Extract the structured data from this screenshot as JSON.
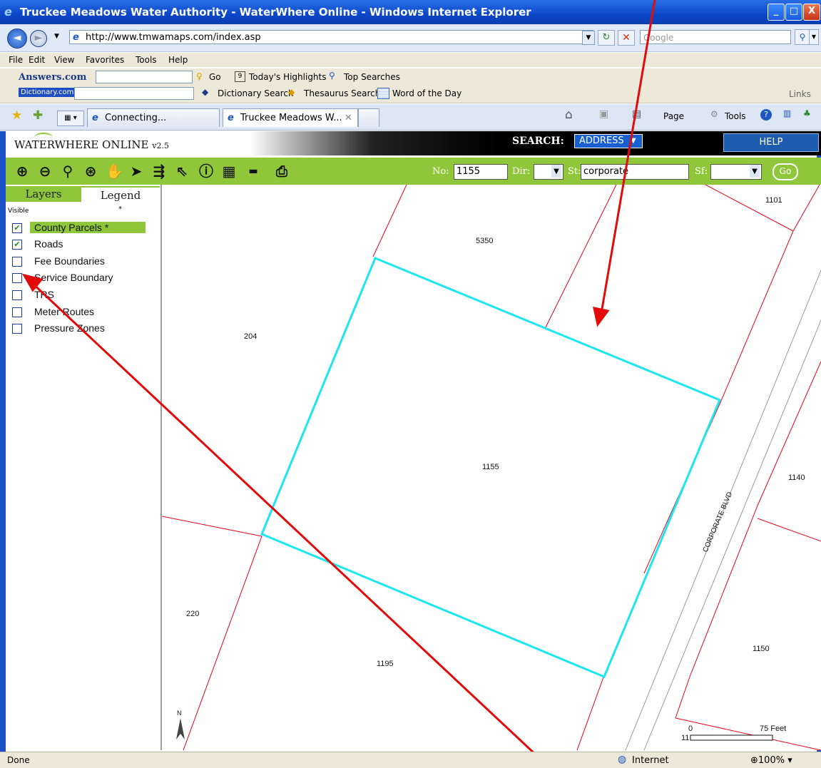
{
  "window": {
    "title": "Truckee Meadows Water Authority - WaterWhere Online - Windows Internet Explorer",
    "min": "_",
    "max": "□",
    "close": "X"
  },
  "address": {
    "url": "http://www.tmwamaps.com/index.asp",
    "search_placeholder": "Google"
  },
  "menu": [
    "File",
    "Edit",
    "View",
    "Favorites",
    "Tools",
    "Help"
  ],
  "answers_bar": {
    "brand": "Answers.com",
    "go": "Go",
    "highlights": "Today's Highlights",
    "top_searches": "Top Searches"
  },
  "dict_bar": {
    "brand": "Dictionary.com",
    "dictionary_search": "Dictionary Search",
    "thesaurus_search": "Thesaurus Search",
    "word_of_day": "Word of the Day",
    "links": "Links"
  },
  "tabs": {
    "tab1": "Connecting...",
    "tab2": "Truckee Meadows W...",
    "page": "Page",
    "tools": "Tools"
  },
  "app": {
    "title": "WATERWHERE ONLINE",
    "version": "v2.5",
    "search_label": "SEARCH:",
    "search_mode": "ADDRESS",
    "help": "HELP"
  },
  "address_search": {
    "no_label": "No:",
    "no_value": "1155",
    "dir_label": "Dir:",
    "dir_value": "",
    "st_label": "St:",
    "st_value": "corporate",
    "sf_label": "Sf:",
    "sf_value": "",
    "go": "Go"
  },
  "panel": {
    "tab_layers": "Layers",
    "tab_legend": "Legend",
    "visible_header": "Visible",
    "star_header": "*",
    "layers": [
      {
        "label": "County Parcels *",
        "checked": true,
        "active": true
      },
      {
        "label": "Roads",
        "checked": true,
        "active": false
      },
      {
        "label": "Fee Boundaries",
        "checked": false,
        "active": false
      },
      {
        "label": "Service Boundary",
        "checked": false,
        "active": false
      },
      {
        "label": "TRS",
        "checked": false,
        "active": false
      },
      {
        "label": "Meter Routes",
        "checked": false,
        "active": false
      },
      {
        "label": "Pressure Zones",
        "checked": false,
        "active": false
      }
    ]
  },
  "map": {
    "parcels": [
      "1101",
      "5350",
      "204",
      "1155",
      "1140",
      "220",
      "1195",
      "1150",
      "11"
    ],
    "street": "CORPORATE BLVD",
    "north": "N",
    "scale_zero": "0",
    "scale_end": "75 Feet"
  },
  "status": {
    "text": "Done",
    "zone": "Internet",
    "zoom": "100%"
  }
}
